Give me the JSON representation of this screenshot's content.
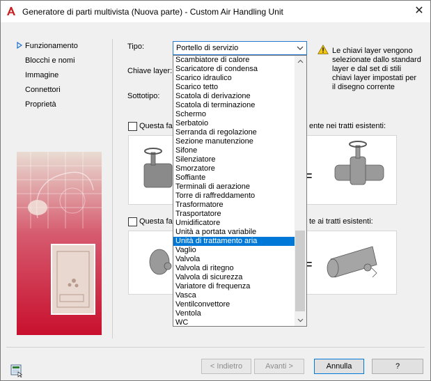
{
  "window": {
    "title": "Generatore di parti multivista (Nuova parte) - Custom Air Handling Unit",
    "close_glyph": "✕"
  },
  "nav": {
    "items": [
      {
        "label": "Funzionamento",
        "active": true
      },
      {
        "label": "Blocchi e nomi",
        "active": false
      },
      {
        "label": "Immagine",
        "active": false
      },
      {
        "label": "Connettori",
        "active": false
      },
      {
        "label": "Proprietà",
        "active": false
      }
    ]
  },
  "form": {
    "tipo_label": "Tipo:",
    "chiave_label": "Chiave layer:",
    "sottotipo_label": "Sottotipo:",
    "tipo_value": "Portello di servizio"
  },
  "warning": {
    "text": "Le chiavi layer vengono selezionate dallo standard layer e dal set di stili chiavi layer impostati per il disegno corrente",
    "color": "#f2c811"
  },
  "options": {
    "check1_prefix": "Questa far",
    "check1_suffix": "ente nei tratti esistenti:",
    "check2_prefix": "Questa far",
    "check2_suffix": "te ai tratti esistenti:",
    "equals": "="
  },
  "dropdown": {
    "items": [
      "Scambiatore di calore",
      "Scaricatore di condensa",
      "Scarico idraulico",
      "Scarico tetto",
      "Scatola di derivazione",
      "Scatola di terminazione",
      "Schermo",
      "Serbatoio",
      "Serranda di regolazione",
      "Sezione manutenzione",
      "Sifone",
      "Silenziatore",
      "Smorzatore",
      "Soffiante",
      "Terminali di aerazione",
      "Torre di raffreddamento",
      "Trasformatore",
      "Trasportatore",
      "Umidificatore",
      "Unità a portata variabile",
      "Unità di trattamento aria",
      "Vaglio",
      "Valvola",
      "Valvola di ritegno",
      "Valvola di sicurezza",
      "Variatore di frequenza",
      "Vasca",
      "Ventilconvettore",
      "Ventola",
      "WC"
    ],
    "selected": "Unità di trattamento aria",
    "selection_color": "#0078d7"
  },
  "buttons": {
    "back": "< Indietro",
    "next": "Avanti >",
    "cancel": "Annulla",
    "help": "?"
  },
  "colors": {
    "app_icon": "#c81e1e",
    "illustration_red": "#c8102e"
  }
}
